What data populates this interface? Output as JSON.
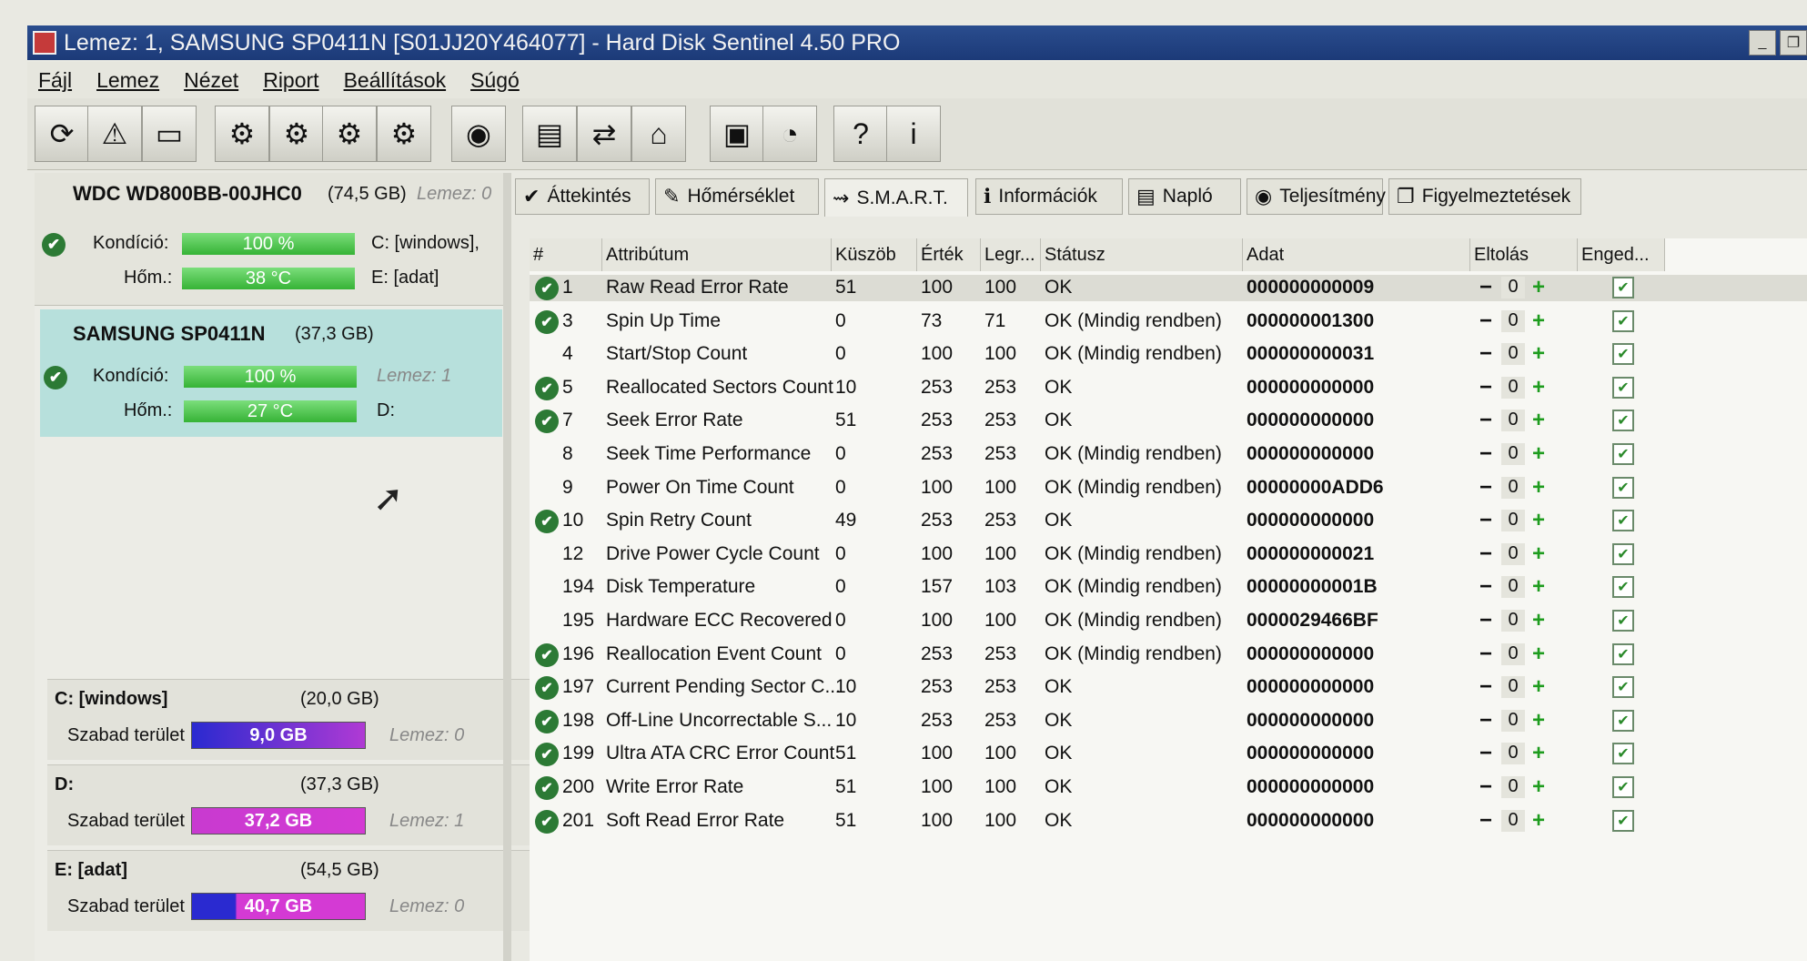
{
  "window": {
    "title": "Lemez: 1, SAMSUNG SP0411N [S01JJ20Y464077]  -  Hard Disk Sentinel 4.50 PRO"
  },
  "menu": [
    "Fájl",
    "Lemez",
    "Nézet",
    "Riport",
    "Beállítások",
    "Súgó"
  ],
  "toolbar": [
    {
      "name": "refresh-icon",
      "glyph": "⟳"
    },
    {
      "name": "alert-icon",
      "glyph": "⚠"
    },
    {
      "name": "disk-info-icon",
      "glyph": "▭"
    },
    {
      "name": "disk-test-icon",
      "glyph": "⚙"
    },
    {
      "name": "disk-surface-icon",
      "glyph": "⚙"
    },
    {
      "name": "disk-ok-icon",
      "glyph": "⚙"
    },
    {
      "name": "disk-tools-icon",
      "glyph": "⚙"
    },
    {
      "name": "globe-icon",
      "glyph": "◉"
    },
    {
      "name": "report-icon",
      "glyph": "▤"
    },
    {
      "name": "sync-icon",
      "glyph": "⇄"
    },
    {
      "name": "network-icon",
      "glyph": "⌂"
    },
    {
      "name": "monitor-icon",
      "glyph": "▣"
    },
    {
      "name": "sound-icon",
      "glyph": "◔"
    },
    {
      "name": "help-icon",
      "glyph": "?"
    },
    {
      "name": "info-icon",
      "glyph": "i"
    }
  ],
  "disks": [
    {
      "name": "WDC WD800BB-00JHC0",
      "size": "(74,5 GB)",
      "lemez": "Lemez: 0",
      "kondicio_label": "Kondíció:",
      "kondicio": "100 %",
      "kondicio_fill": 1.0,
      "kondicio_note": "C: [windows],",
      "hom_label": "Hőm.:",
      "hom": "38 °C",
      "hom_note": "E: [adat]"
    },
    {
      "name": "SAMSUNG  SP0411N",
      "size": "(37,3 GB)",
      "kondicio_label": "Kondíció:",
      "kondicio": "100 %",
      "kondicio_fill": 1.0,
      "kondicio_note": "Lemez: 1",
      "hom_label": "Hőm.:",
      "hom": "27 °C",
      "hom_note": "D:"
    }
  ],
  "volumes": [
    {
      "name": "C: [windows]",
      "size": "(20,0 GB)",
      "free_label": "Szabad terület",
      "free": "9,0 GB",
      "free_fraction": 0.45,
      "lemez": "Lemez: 0"
    },
    {
      "name": "D:",
      "size": "(37,3 GB)",
      "free_label": "Szabad terület",
      "free": "37,2 GB",
      "free_fraction": 1.0,
      "lemez": "Lemez: 1"
    },
    {
      "name": "E: [adat]",
      "size": "(54,5 GB)",
      "free_label": "Szabad terület",
      "free": "40,7 GB",
      "free_fraction": 0.75,
      "lemez": "Lemez: 0"
    }
  ],
  "tabs": [
    {
      "label": "Áttekintés",
      "icon": "✔"
    },
    {
      "label": "Hőmérséklet",
      "icon": "✎"
    },
    {
      "label": "S.M.A.R.T.",
      "icon": "⇝"
    },
    {
      "label": "Információk",
      "icon": "ℹ"
    },
    {
      "label": "Napló",
      "icon": "▤"
    },
    {
      "label": "Teljesítmény",
      "icon": "◉"
    },
    {
      "label": "Figyelmeztetések",
      "icon": "❐"
    }
  ],
  "active_tab": "S.M.A.R.T.",
  "smart": {
    "columns": [
      "#",
      "Attribútum",
      "Küszöb",
      "Érték",
      "Legr...",
      "Státusz",
      "Adat",
      "Eltolás",
      "Enged..."
    ],
    "rows": [
      {
        "check": true,
        "id": "1",
        "attr": "Raw Read Error Rate",
        "kuszob": "51",
        "ertek": "100",
        "legr": "100",
        "status": "OK",
        "adat": "000000000009",
        "offset": "0"
      },
      {
        "check": true,
        "id": "3",
        "attr": "Spin Up Time",
        "kuszob": "0",
        "ertek": "73",
        "legr": "71",
        "status": "OK (Mindig rendben)",
        "adat": "000000001300",
        "offset": "0"
      },
      {
        "check": false,
        "id": "4",
        "attr": "Start/Stop Count",
        "kuszob": "0",
        "ertek": "100",
        "legr": "100",
        "status": "OK (Mindig rendben)",
        "adat": "000000000031",
        "offset": "0"
      },
      {
        "check": true,
        "id": "5",
        "attr": "Reallocated Sectors Count",
        "kuszob": "10",
        "ertek": "253",
        "legr": "253",
        "status": "OK",
        "adat": "000000000000",
        "offset": "0"
      },
      {
        "check": true,
        "id": "7",
        "attr": "Seek Error Rate",
        "kuszob": "51",
        "ertek": "253",
        "legr": "253",
        "status": "OK",
        "adat": "000000000000",
        "offset": "0"
      },
      {
        "check": false,
        "id": "8",
        "attr": "Seek Time Performance",
        "kuszob": "0",
        "ertek": "253",
        "legr": "253",
        "status": "OK (Mindig rendben)",
        "adat": "000000000000",
        "offset": "0"
      },
      {
        "check": false,
        "id": "9",
        "attr": "Power On Time Count",
        "kuszob": "0",
        "ertek": "100",
        "legr": "100",
        "status": "OK (Mindig rendben)",
        "adat": "00000000ADD6",
        "offset": "0"
      },
      {
        "check": true,
        "id": "10",
        "attr": "Spin Retry Count",
        "kuszob": "49",
        "ertek": "253",
        "legr": "253",
        "status": "OK",
        "adat": "000000000000",
        "offset": "0"
      },
      {
        "check": false,
        "id": "12",
        "attr": "Drive Power Cycle Count",
        "kuszob": "0",
        "ertek": "100",
        "legr": "100",
        "status": "OK (Mindig rendben)",
        "adat": "000000000021",
        "offset": "0"
      },
      {
        "check": false,
        "id": "194",
        "attr": "Disk Temperature",
        "kuszob": "0",
        "ertek": "157",
        "legr": "103",
        "status": "OK (Mindig rendben)",
        "adat": "00000000001B",
        "offset": "0"
      },
      {
        "check": false,
        "id": "195",
        "attr": "Hardware ECC Recovered",
        "kuszob": "0",
        "ertek": "100",
        "legr": "100",
        "status": "OK (Mindig rendben)",
        "adat": "0000029466BF",
        "offset": "0"
      },
      {
        "check": true,
        "id": "196",
        "attr": "Reallocation Event Count",
        "kuszob": "0",
        "ertek": "253",
        "legr": "253",
        "status": "OK (Mindig rendben)",
        "adat": "000000000000",
        "offset": "0"
      },
      {
        "check": true,
        "id": "197",
        "attr": "Current Pending Sector C...",
        "kuszob": "10",
        "ertek": "253",
        "legr": "253",
        "status": "OK",
        "adat": "000000000000",
        "offset": "0"
      },
      {
        "check": true,
        "id": "198",
        "attr": "Off-Line Uncorrectable S...",
        "kuszob": "10",
        "ertek": "253",
        "legr": "253",
        "status": "OK",
        "adat": "000000000000",
        "offset": "0"
      },
      {
        "check": true,
        "id": "199",
        "attr": "Ultra ATA CRC Error Count",
        "kuszob": "51",
        "ertek": "100",
        "legr": "100",
        "status": "OK",
        "adat": "000000000000",
        "offset": "0"
      },
      {
        "check": true,
        "id": "200",
        "attr": "Write Error Rate",
        "kuszob": "51",
        "ertek": "100",
        "legr": "100",
        "status": "OK",
        "adat": "000000000000",
        "offset": "0"
      },
      {
        "check": true,
        "id": "201",
        "attr": "Soft Read Error Rate",
        "kuszob": "51",
        "ertek": "100",
        "legr": "100",
        "status": "OK",
        "adat": "000000000000",
        "offset": "0"
      }
    ]
  },
  "colors": {
    "title_bar": "#1c3a78",
    "health_bar": "#36b336",
    "selected_disk": "#b7e0dc",
    "ok_check": "#2c7a35",
    "volume_bar_start": "#2a2ad0",
    "volume_bar_end": "#d43ad4"
  }
}
